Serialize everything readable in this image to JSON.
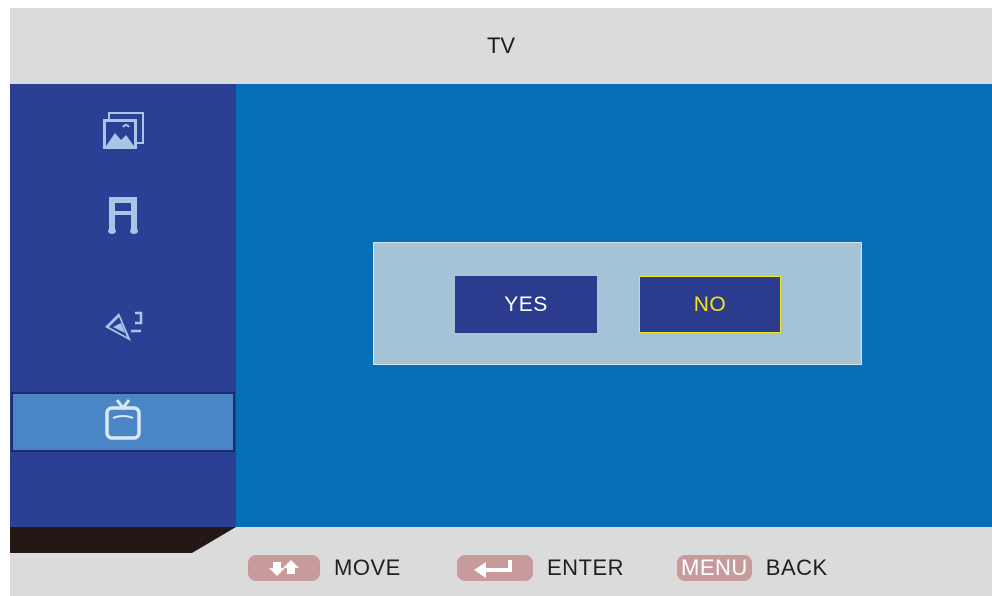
{
  "header": {
    "title": "TV"
  },
  "sidebar": {
    "items": [
      {
        "name": "picture",
        "icon": "picture-icon",
        "selected": false
      },
      {
        "name": "sound",
        "icon": "music-note-icon",
        "selected": false
      },
      {
        "name": "setup",
        "icon": "pen-icon",
        "selected": false
      },
      {
        "name": "tv",
        "icon": "tv-icon",
        "selected": true
      }
    ]
  },
  "dialog": {
    "yes_label": "YES",
    "no_label": "NO",
    "focused": "NO"
  },
  "footer": {
    "hints": [
      {
        "key_icon": "arrows-up-down-icon",
        "label": "MOVE"
      },
      {
        "key_icon": "enter-arrow-icon",
        "label": "ENTER"
      },
      {
        "key_label": "MENU",
        "label": "BACK"
      }
    ]
  },
  "colors": {
    "header_bg": "#dcdbdb",
    "sidebar_bg": "#2b3f94",
    "sidebar_selected": "#4a86c5",
    "content_bg": "#066db8",
    "dialog_bg": "#a4c3d6",
    "button_bg": "#2b3b8e",
    "focus_color": "#f4e21b",
    "key_bg": "#c79a9c"
  }
}
